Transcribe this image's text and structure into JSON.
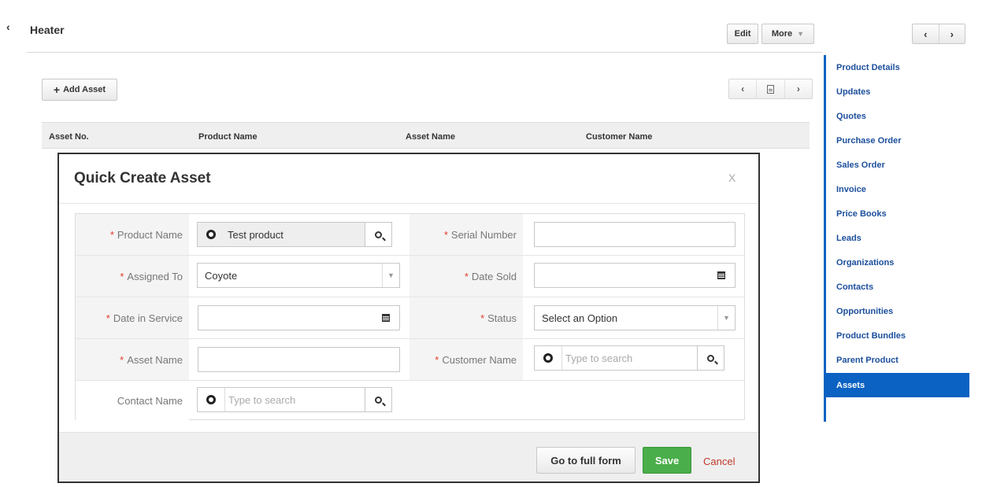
{
  "header": {
    "title": "Heater",
    "edit_label": "Edit",
    "more_label": "More",
    "collapse_icon": "chevron-left-icon",
    "prev_icon": "chevron-left-icon",
    "next_icon": "chevron-right-icon"
  },
  "related_list": {
    "add_label": "Add Asset",
    "columns": [
      "Asset No.",
      "Product Name",
      "Asset Name",
      "Customer Name"
    ]
  },
  "sidebar": {
    "items": [
      {
        "label": "Product Details"
      },
      {
        "label": "Updates"
      },
      {
        "label": "Quotes"
      },
      {
        "label": "Purchase Order"
      },
      {
        "label": "Sales Order"
      },
      {
        "label": "Invoice"
      },
      {
        "label": "Price Books"
      },
      {
        "label": "Leads"
      },
      {
        "label": "Organizations"
      },
      {
        "label": "Contacts"
      },
      {
        "label": "Opportunities"
      },
      {
        "label": "Product Bundles"
      },
      {
        "label": "Parent Product"
      },
      {
        "label": "Assets"
      }
    ],
    "active": "Assets",
    "accent_color": "#0b62c2"
  },
  "modal": {
    "title": "Quick Create Asset",
    "close_label": "X",
    "fields": {
      "product_name": {
        "label": "Product Name",
        "value": "Test product",
        "required": "*"
      },
      "serial_number": {
        "label": "Serial Number",
        "value": "",
        "required": "*"
      },
      "assigned_to": {
        "label": "Assigned To",
        "value": "Coyote",
        "required": "*"
      },
      "date_sold": {
        "label": "Date Sold",
        "value": "",
        "required": "*"
      },
      "date_in_service": {
        "label": "Date in Service",
        "value": "",
        "required": "*"
      },
      "status": {
        "label": "Status",
        "value": "Select an Option",
        "required": "*"
      },
      "asset_name": {
        "label": "Asset Name",
        "value": "",
        "required": "*"
      },
      "customer_name": {
        "label": "Customer Name",
        "placeholder": "Type to search",
        "required": "*"
      },
      "contact_name": {
        "label": "Contact Name",
        "placeholder": "Type to search"
      }
    },
    "footer": {
      "full_form_label": "Go to full form",
      "save_label": "Save",
      "cancel_label": "Cancel"
    },
    "save_color": "#4aae4a",
    "required_color": "#e23b2a"
  }
}
